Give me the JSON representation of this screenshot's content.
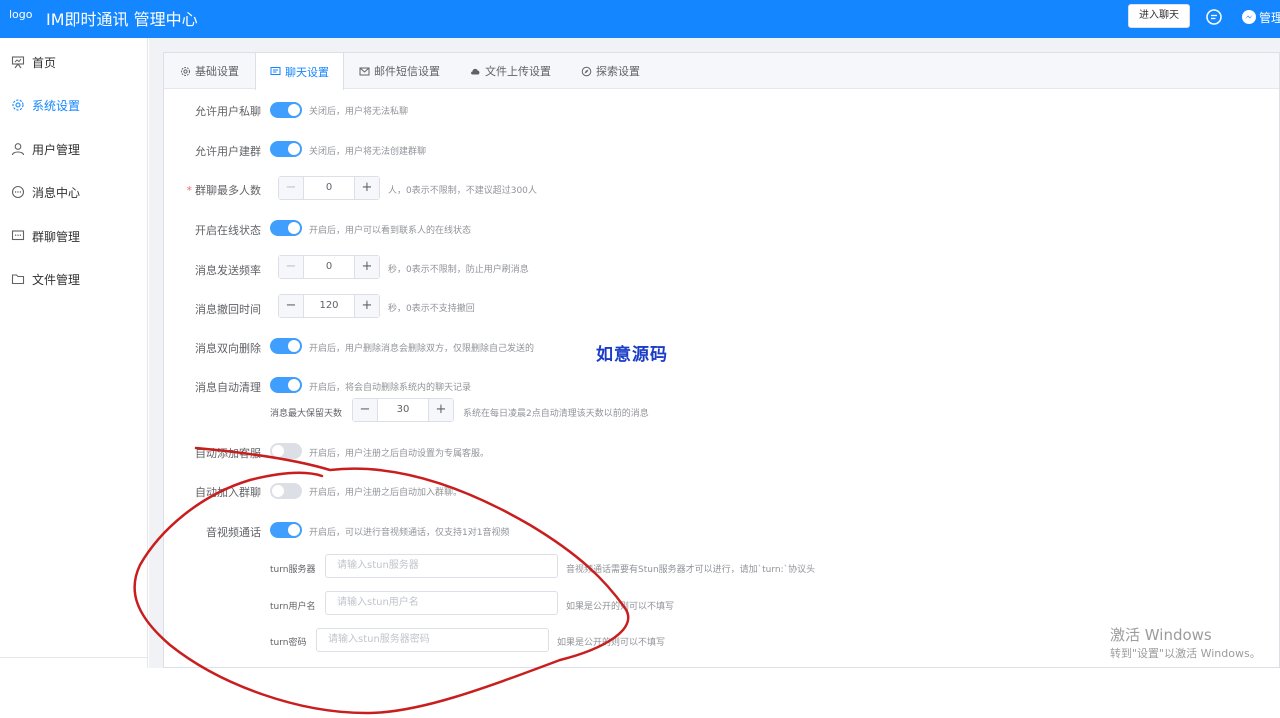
{
  "header": {
    "logo_alt": "logo",
    "title": "IM即时通讯 管理中心",
    "enter_chat": "进入聊天",
    "admin": "管理"
  },
  "sidebar": {
    "items": [
      {
        "label": "首页",
        "icon": "presentation-icon"
      },
      {
        "label": "系统设置",
        "icon": "gear-icon",
        "active": true
      },
      {
        "label": "用户管理",
        "icon": "user-icon"
      },
      {
        "label": "消息中心",
        "icon": "chat-bubble-icon"
      },
      {
        "label": "群聊管理",
        "icon": "group-chat-icon"
      },
      {
        "label": "文件管理",
        "icon": "folder-icon"
      }
    ]
  },
  "tabs": [
    {
      "label": "基础设置",
      "icon": "gear-icon"
    },
    {
      "label": "聊天设置",
      "icon": "chat-bubble-icon",
      "active": true
    },
    {
      "label": "邮件短信设置",
      "icon": "mail-icon"
    },
    {
      "label": "文件上传设置",
      "icon": "cloud-upload-icon"
    },
    {
      "label": "探索设置",
      "icon": "compass-icon"
    }
  ],
  "form": {
    "private_chat": {
      "label": "允许用户私聊",
      "hint": "关闭后，用户将无法私聊",
      "on": true
    },
    "create_group": {
      "label": "允许用户建群",
      "hint": "关闭后，用户将无法创建群聊",
      "on": true
    },
    "group_max": {
      "label": "群聊最多人数",
      "value": "0",
      "hint": "人，0表示不限制，不建议超过300人",
      "required": true
    },
    "online_status": {
      "label": "开启在线状态",
      "hint": "开启后，用户可以看到联系人的在线状态",
      "on": true
    },
    "send_rate": {
      "label": "消息发送频率",
      "value": "0",
      "hint": "秒，0表示不限制，防止用户刷消息"
    },
    "recall_time": {
      "label": "消息撤回时间",
      "value": "120",
      "hint": "秒，0表示不支持撤回"
    },
    "bidirectional_delete": {
      "label": "消息双向删除",
      "hint": "开启后，用户删除消息会删除双方，仅限删除自己发送的",
      "on": true
    },
    "auto_clean": {
      "label": "消息自动清理",
      "hint": "开启后，将会自动删除系统内的聊天记录",
      "on": true,
      "retention_label": "消息最大保留天数",
      "retention_value": "30",
      "retention_hint": "系统在每日凌晨2点自动清理该天数以前的消息"
    },
    "auto_add_service": {
      "label": "自动添加客服",
      "hint": "开启后，用户注册之后自动设置为专属客服。",
      "on": false
    },
    "auto_join_group": {
      "label": "自动加入群聊",
      "hint": "开启后，用户注册之后自动加入群聊。",
      "on": false
    },
    "av_call": {
      "label": "音视频通话",
      "hint": "开启后，可以进行音视频通话，仅支持1对1音视频",
      "on": true
    },
    "turn_server": {
      "label": "turn服务器",
      "placeholder": "请输入stun服务器",
      "hint": "音视频通话需要有Stun服务器才可以进行，请加`turn:`协议头"
    },
    "turn_user": {
      "label": "turn用户名",
      "placeholder": "请输入stun用户名",
      "hint": "如果是公开的则可以不填写"
    },
    "turn_password": {
      "label": "turn密码",
      "placeholder": "请输入stun服务器密码",
      "hint": "如果是公开的则可以不填写"
    }
  },
  "watermark": "如意源码",
  "windows_activation": {
    "title": "激活 Windows",
    "subtitle": "转到\"设置\"以激活 Windows。"
  }
}
